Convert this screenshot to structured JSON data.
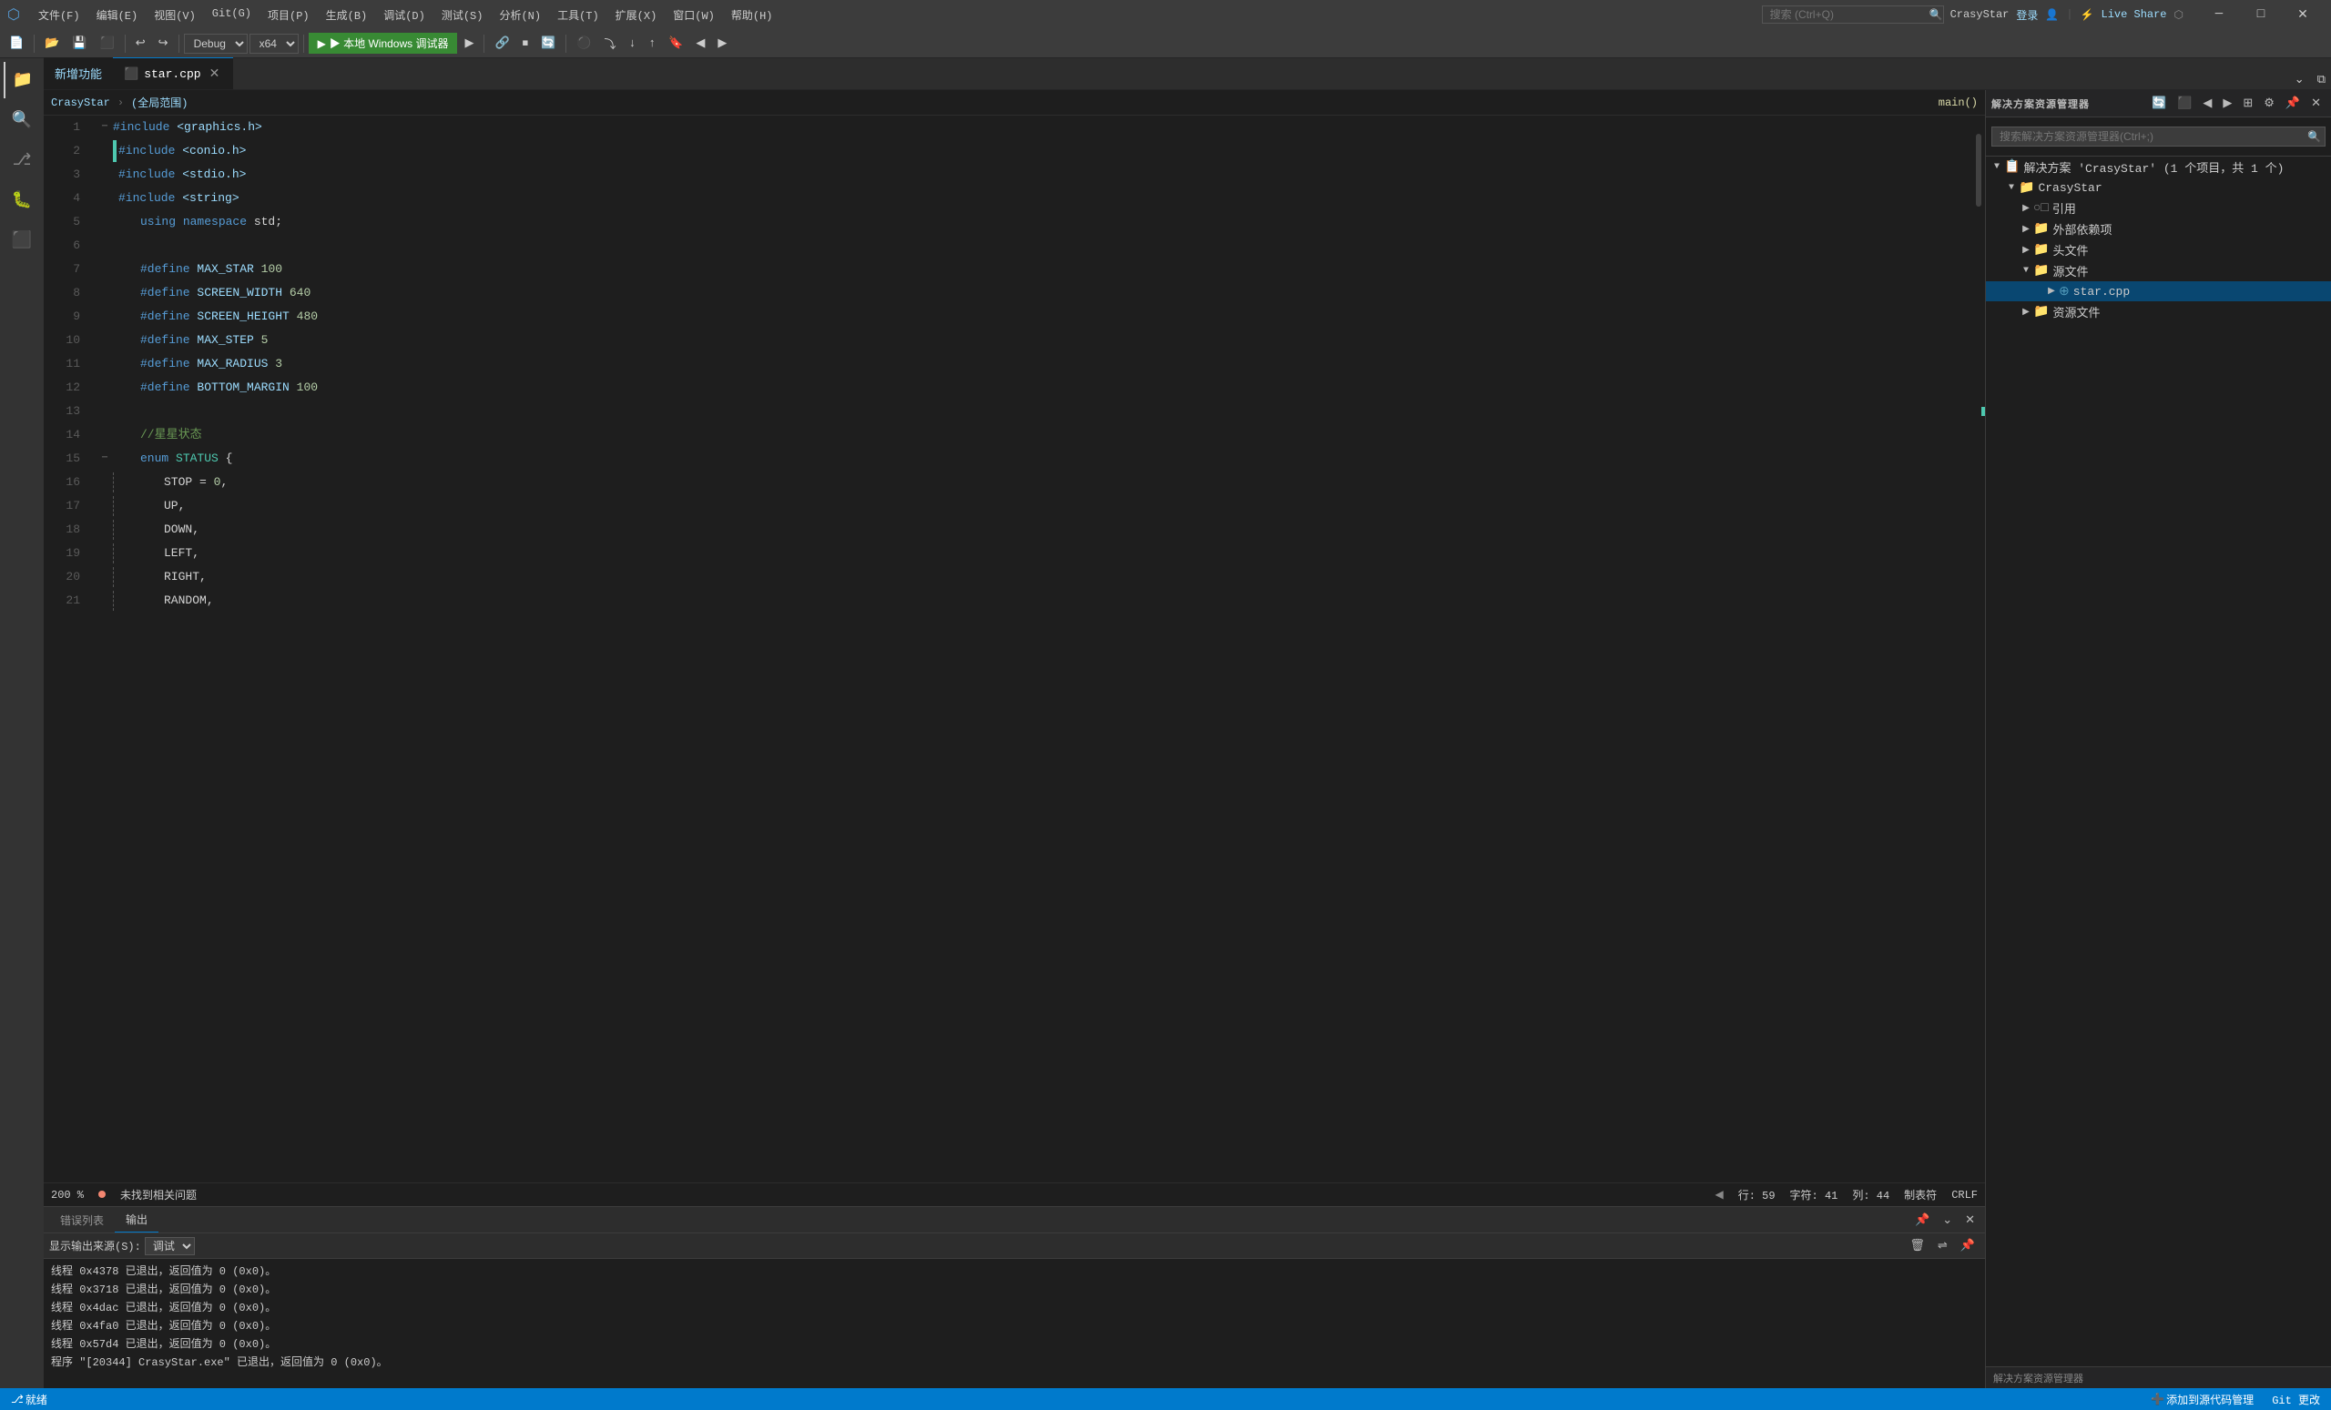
{
  "titlebar": {
    "menus": [
      "文件(F)",
      "编辑(E)",
      "视图(V)",
      "Git(G)",
      "项目(P)",
      "生成(B)",
      "调试(D)",
      "测试(S)",
      "分析(N)",
      "工具(T)",
      "扩展(X)",
      "窗口(W)",
      "帮助(H)"
    ],
    "search_placeholder": "搜索 (Ctrl+Q)",
    "app_name": "CrasyStar",
    "login": "登录",
    "live_share": "Live Share",
    "minimize": "─",
    "maximize": "□",
    "close": "✕"
  },
  "toolbar": {
    "config": "Debug",
    "platform": "x64",
    "run_label": "▶ 本地 Windows 调试器",
    "new_feature": "新增功能"
  },
  "editor": {
    "filename": "star.cpp",
    "breadcrumb_project": "CrasyStar",
    "breadcrumb_scope": "(全局范围)",
    "breadcrumb_func": "main()",
    "lines": [
      {
        "n": 1,
        "code": "#include <graphics.h>",
        "type": "include"
      },
      {
        "n": 2,
        "code": "#include <conio.h>",
        "type": "include"
      },
      {
        "n": 3,
        "code": "#include <stdio.h>",
        "type": "include"
      },
      {
        "n": 4,
        "code": "#include <string>",
        "type": "include"
      },
      {
        "n": 5,
        "code": "    using namespace std;",
        "type": "plain"
      },
      {
        "n": 6,
        "code": "",
        "type": "empty"
      },
      {
        "n": 7,
        "code": "    #define MAX_STAR 100",
        "type": "define"
      },
      {
        "n": 8,
        "code": "    #define SCREEN_WIDTH 640",
        "type": "define"
      },
      {
        "n": 9,
        "code": "    #define SCREEN_HEIGHT 480",
        "type": "define"
      },
      {
        "n": 10,
        "code": "    #define MAX_STEP 5",
        "type": "define"
      },
      {
        "n": 11,
        "code": "    #define MAX_RADIUS 3",
        "type": "define"
      },
      {
        "n": 12,
        "code": "    #define BOTTOM_MARGIN 100",
        "type": "define"
      },
      {
        "n": 13,
        "code": "",
        "type": "empty"
      },
      {
        "n": 14,
        "code": "    //星星状态",
        "type": "comment"
      },
      {
        "n": 15,
        "code": "    enum STATUS {",
        "type": "enum"
      },
      {
        "n": 16,
        "code": "        STOP = 0,",
        "type": "enum_val"
      },
      {
        "n": 17,
        "code": "        UP,",
        "type": "enum_val"
      },
      {
        "n": 18,
        "code": "        DOWN,",
        "type": "enum_val"
      },
      {
        "n": 19,
        "code": "        LEFT,",
        "type": "enum_val"
      },
      {
        "n": 20,
        "code": "        RIGHT,",
        "type": "enum_val"
      },
      {
        "n": 21,
        "code": "        RANDOM,",
        "type": "enum_val"
      }
    ]
  },
  "statusbar": {
    "row": "行: 59",
    "char": "字符: 41",
    "col": "列: 44",
    "format": "制表符",
    "encoding": "CRLF",
    "errors": "未找到相关问题",
    "zoom": "200 %",
    "git": "Git 更改",
    "add_to_source": "添加到源代码管理",
    "ready": "就绪"
  },
  "output": {
    "panel_title": "输出",
    "source_label": "显示输出来源(S):",
    "source": "调试",
    "lines": [
      "线程 0x4378 已退出，返回值为 0 (0x0)。",
      "线程 0x3718 已退出，返回值为 0 (0x0)。",
      "线程 0x4dac 已退出，返回值为 0 (0x0)。",
      "线程 0x4fa0 已退出，返回值为 0 (0x0)。",
      "线程 0x57d4 已退出，返回值为 0 (0x0)。",
      "程序 \"[20344] CrasyStar.exe\" 已退出，返回值为 0 (0x0)。"
    ]
  },
  "solution_panel": {
    "title": "解决方案资源管理器",
    "search_placeholder": "搜索解决方案资源管理器(Ctrl+;)",
    "solution": "解决方案 'CrasyStar' (1 个项目，共 1 个)",
    "project": "CrasyStar",
    "nodes": [
      {
        "label": "引用",
        "icon": "ref",
        "level": 2
      },
      {
        "label": "外部依赖项",
        "icon": "folder",
        "level": 2
      },
      {
        "label": "头文件",
        "icon": "folder",
        "level": 2
      },
      {
        "label": "源文件",
        "icon": "folder",
        "level": 2,
        "expanded": true
      },
      {
        "label": "star.cpp",
        "icon": "cpp",
        "level": 3
      },
      {
        "label": "资源文件",
        "icon": "folder",
        "level": 2
      }
    ]
  },
  "bottom_tabs": [
    "错误列表",
    "输出"
  ],
  "tab_bar": {
    "new_feature_tab": "新增功能",
    "file_tab": "star.cpp"
  }
}
